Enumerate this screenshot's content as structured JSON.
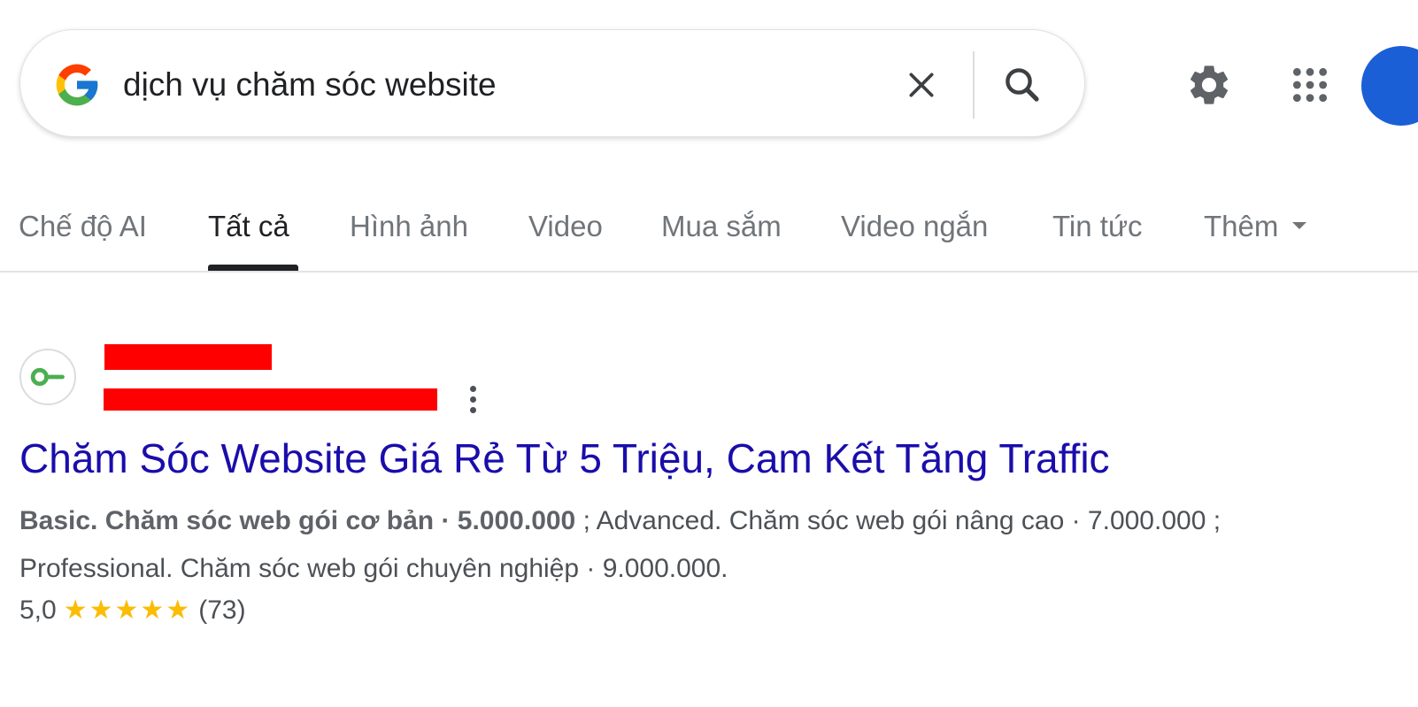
{
  "search": {
    "query": "dịch vụ chăm sóc website"
  },
  "icons": {
    "logo": "google-g-icon",
    "clear": "close-icon",
    "search": "search-icon",
    "settings": "gear-icon",
    "apps": "apps-grid-icon",
    "avatar": "avatar"
  },
  "tabs": [
    {
      "label": "Chế độ AI",
      "active": false
    },
    {
      "label": "Tất cả",
      "active": true
    },
    {
      "label": "Hình ảnh",
      "active": false
    },
    {
      "label": "Video",
      "active": false
    },
    {
      "label": "Mua sắm",
      "active": false
    },
    {
      "label": "Video ngắn",
      "active": false
    },
    {
      "label": "Tin tức",
      "active": false
    },
    {
      "label": "Thêm",
      "active": false
    }
  ],
  "result": {
    "title": "Chăm Sóc Website Giá Rẻ Từ 5 Triệu, Cam Kết Tăng Traffic",
    "snippet_bold": "Basic. Chăm sóc web gói cơ bản · 5.000.000",
    "snippet_line1_rest": " ; Advanced. Chăm sóc web gói nâng cao · 7.000.000 ;",
    "snippet_line2": "Professional. Chăm sóc web gói chuyên nghiệp · 9.000.000.",
    "rating_value": "5,0",
    "rating_stars": 5,
    "rating_count": "(73)"
  },
  "colors": {
    "link": "#1a0dab",
    "star": "#fbbc04",
    "redaction": "#ff0000",
    "avatar": "#1a5fd6",
    "favicon": "#4caf50"
  }
}
